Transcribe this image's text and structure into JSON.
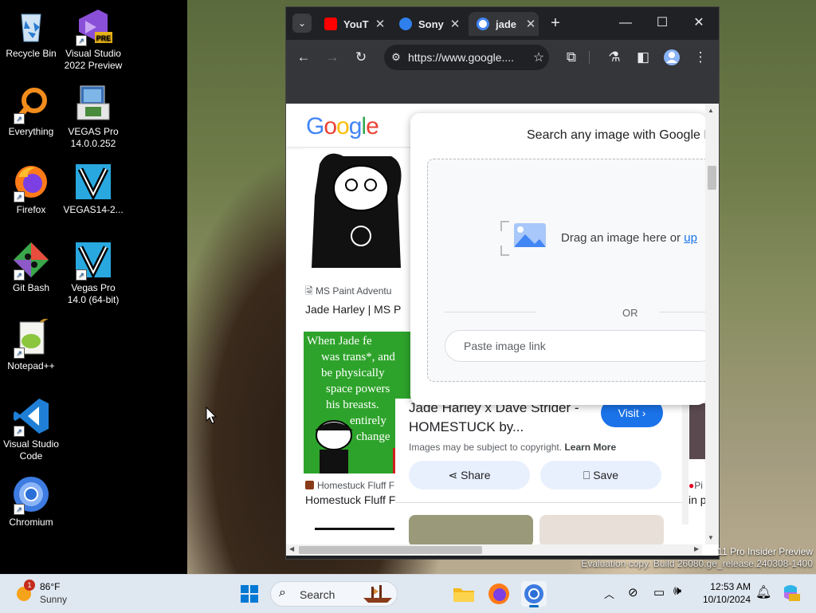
{
  "desktop": {
    "icons": [
      {
        "label": "Recycle Bin"
      },
      {
        "label": "Visual Studio 2022 Preview",
        "badge": "PRE"
      },
      {
        "label": "Everything"
      },
      {
        "label": "VEGAS Pro 14.0.0.252"
      },
      {
        "label": "Firefox"
      },
      {
        "label": "VEGAS14-2..."
      },
      {
        "label": "Git Bash"
      },
      {
        "label": "Vegas Pro 14.0 (64-bit)"
      },
      {
        "label": "Notepad++"
      },
      {
        "label": "Visual Studio Code"
      },
      {
        "label": "Chromium"
      }
    ]
  },
  "browser": {
    "tabs": [
      {
        "title": "YouT",
        "icon": "youtube-icon",
        "color": "#ff0000"
      },
      {
        "title": "Sony",
        "icon": "edge-icon",
        "color": "#2f80ed"
      },
      {
        "title": "jade",
        "icon": "google-icon",
        "color": "#4285f4",
        "active": true
      }
    ],
    "url": "https://www.google...."
  },
  "page": {
    "logo": "Google",
    "lens": {
      "title": "Search any image with Google L",
      "drag_text": "Drag an image here or ",
      "upload_link": "up",
      "or_text": "OR",
      "paste_placeholder": "Paste image link"
    },
    "results": [
      {
        "source": "MS Paint Adventu",
        "title": "Jade Harley | MS P"
      },
      {
        "source": "Homestuck Fluff F",
        "title": "Homestuck Fluff F"
      }
    ],
    "comic_text": [
      "When Jade fe",
      "was trans*, and",
      "be physically",
      "space powers",
      "his breasts.",
      "entirely",
      "change"
    ],
    "side_panel": {
      "title_line1": "Jade Harley x Dave Strider -",
      "title_line2": "HOMESTUCK by...",
      "visit_label": "Visit",
      "copyright": "Images may be subject to copyright.",
      "learn_more": "Learn More",
      "share_label": "Share",
      "save_label": "Save"
    },
    "right_edge_text": [
      "Pi",
      "in p"
    ]
  },
  "watermark": {
    "line1": "11 Pro Insider Preview",
    "line2": "Evaluation copy. Build 26080.ge_release.240308-1400"
  },
  "taskbar": {
    "weather_temp": "86°F",
    "weather_desc": "Sunny",
    "weather_badge": "1",
    "search_label": "Search",
    "time": "12:53 AM",
    "date": "10/10/2024"
  }
}
